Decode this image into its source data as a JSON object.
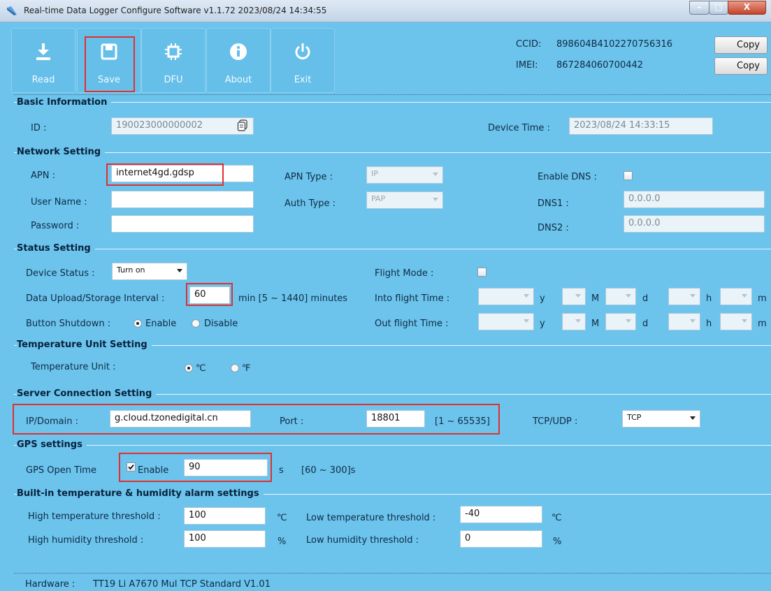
{
  "window": {
    "title": "Real-time Data Logger Configure Software v1.1.72  2023/08/24 14:34:55"
  },
  "toolbar": {
    "read": "Read",
    "save": "Save",
    "dfu": "DFU",
    "about": "About",
    "exit": "Exit"
  },
  "device_info": {
    "ccid_label": "CCID:",
    "ccid_value": "898604B4102270756316",
    "imei_label": "IMEI:",
    "imei_value": "867284060700442",
    "copy_label": "Copy"
  },
  "basic": {
    "title": "Basic Information",
    "id_label": "ID :",
    "id_value": "190023000000002",
    "device_time_label": "Device Time :",
    "device_time_value": "2023/08/24 14:33:15"
  },
  "network": {
    "title": "Network Setting",
    "apn_label": "APN :",
    "apn_value": "internet4gd.gdsp",
    "user_label": "User Name :",
    "user_value": "",
    "password_label": "Password :",
    "password_value": "",
    "apn_type_label": "APN Type :",
    "apn_type_value": "IP",
    "auth_type_label": "Auth Type :",
    "auth_type_value": "PAP",
    "enable_dns_label": "Enable DNS :",
    "dns1_label": "DNS1 :",
    "dns1_value": "0.0.0.0",
    "dns2_label": "DNS2 :",
    "dns2_value": "0.0.0.0"
  },
  "status": {
    "title": "Status Setting",
    "device_status_label": "Device Status :",
    "device_status_value": "Turn on",
    "interval_label": "Data Upload/Storage Interval :",
    "interval_value": "60",
    "interval_unit": "min  [5 ~ 1440] minutes",
    "button_shutdown_label": "Button Shutdown :",
    "enable_label": "Enable",
    "disable_label": "Disable",
    "flight_mode_label": "Flight Mode :",
    "into_flight_label": "Into flight Time :",
    "out_flight_label": "Out flight Time :",
    "unit_y": "y",
    "unit_M": "M",
    "unit_d": "d",
    "unit_h": "h",
    "unit_m": "m"
  },
  "temperature_unit": {
    "title": "Temperature Unit Setting",
    "label": "Temperature Unit :",
    "celsius": "℃",
    "fahrenheit": "℉"
  },
  "server": {
    "title": "Server Connection Setting",
    "ip_label": "IP/Domain :",
    "ip_value": "g.cloud.tzonedigital.cn",
    "port_label": "Port :",
    "port_value": "18801",
    "port_range": "[1 ~ 65535]",
    "protocol_label": "TCP/UDP :",
    "protocol_value": "TCP"
  },
  "gps": {
    "title": "GPS settings",
    "open_time_label": "GPS Open Time",
    "enable_label": "Enable",
    "open_time_value": "90",
    "unit": "s",
    "range": "[60 ~ 300]s"
  },
  "alarm": {
    "title": "Built-in temperature & humidity alarm settings",
    "high_temp_label": "High temperature threshold :",
    "high_temp_value": "100",
    "temp_unit": "℃",
    "low_temp_label": "Low temperature threshold :",
    "low_temp_value": "-40",
    "high_hum_label": "High humidity threshold :",
    "high_hum_value": "100",
    "hum_unit": "%",
    "low_hum_label": "Low humidity threshold :",
    "low_hum_value": "0"
  },
  "footer": {
    "hardware_label": "Hardware :",
    "hardware_value": "TT19 Li A7670 Mul TCP Standard V1.01"
  },
  "colors": {
    "background": "#6cc3ec",
    "highlight": "#e03030"
  }
}
